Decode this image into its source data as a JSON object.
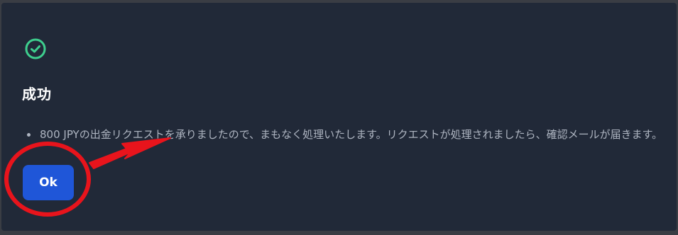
{
  "dialog": {
    "title": "成功",
    "messages": [
      "800 JPYの出金リクエストを承りましたので、まもなく処理いたします。リクエストが処理されましたら、確認メールが届きます。"
    ],
    "ok_label": "Ok"
  },
  "icons": {
    "status": "check-circle-icon"
  },
  "colors": {
    "dialog_background": "#212938",
    "success": "#3ecf8e",
    "primary_button": "#1f56d8",
    "annotation": "#e8141c"
  }
}
